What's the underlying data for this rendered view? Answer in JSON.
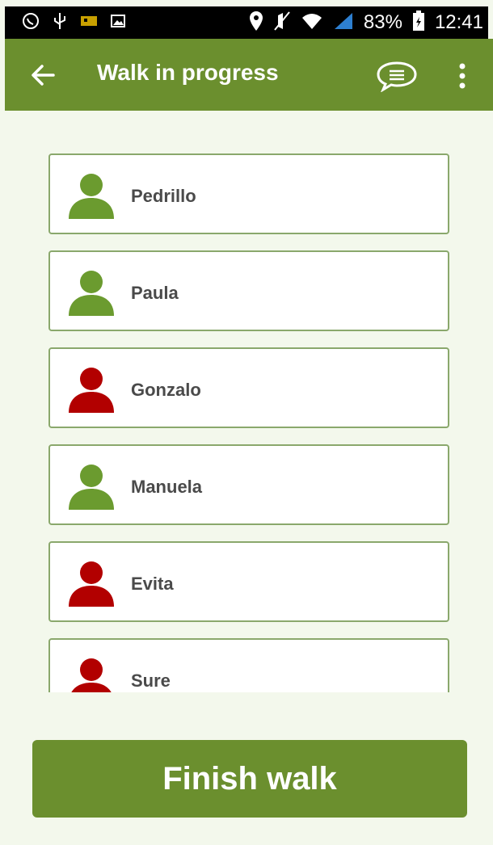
{
  "status_bar": {
    "battery": "83%",
    "time": "12:41",
    "left_icons": [
      "whatsapp-icon",
      "usb-icon",
      "game-icon",
      "image-icon"
    ],
    "right_icons": [
      "location-pin-icon",
      "mute-icon",
      "wifi-icon",
      "signal-icon",
      "battery-icon"
    ]
  },
  "app_bar": {
    "title": "Walk in progress",
    "icons": [
      "back-arrow-icon",
      "chat-bubble-icon",
      "overflow-menu-icon"
    ]
  },
  "participants": [
    {
      "name": "Pedrillo",
      "status_color": "#6b9b2f"
    },
    {
      "name": "Paula",
      "status_color": "#6b9b2f"
    },
    {
      "name": "Gonzalo",
      "status_color": "#b20000"
    },
    {
      "name": "Manuela",
      "status_color": "#6b9b2f"
    },
    {
      "name": "Evita",
      "status_color": "#b20000"
    },
    {
      "name": "Sure",
      "status_color": "#b20000"
    }
  ],
  "finish_button": {
    "label": "Finish walk"
  },
  "colors": {
    "brand": "#6b8f2e",
    "present": "#6b9b2f",
    "absent": "#b20000",
    "background": "#f3f8ec"
  }
}
